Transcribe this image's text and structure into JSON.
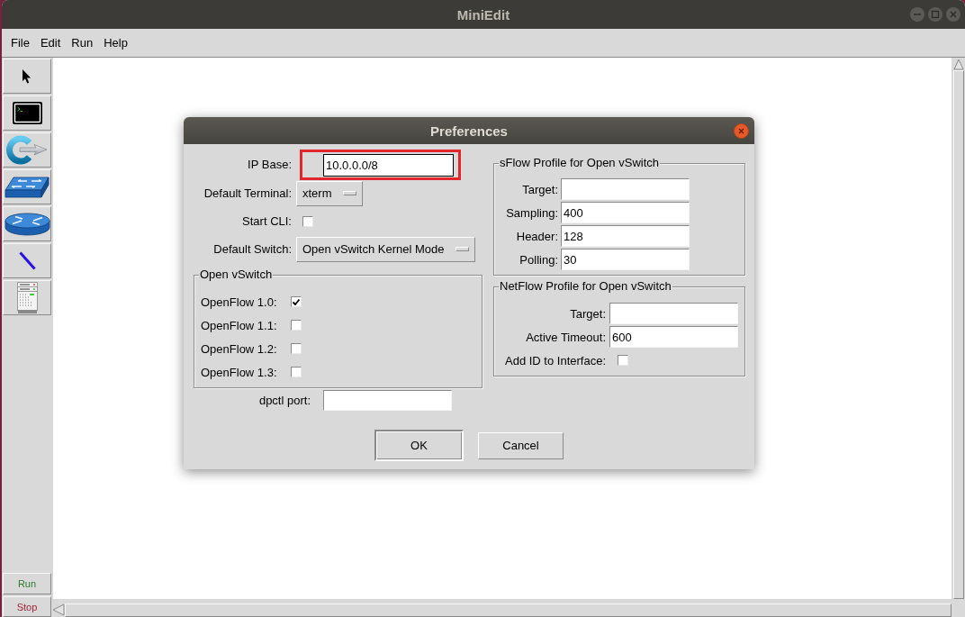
{
  "window": {
    "title": "MiniEdit"
  },
  "menu_bar": [
    "File",
    "Edit",
    "Run",
    "Help"
  ],
  "run_controls": [
    {
      "label": "Run",
      "color": "#2e7d32"
    },
    {
      "label": "Stop",
      "color": "#a3243b"
    }
  ],
  "dialog": {
    "title": "Preferences",
    "general": [
      {
        "kind": "text",
        "label": "IP Base:",
        "value": "10.0.0.0/8",
        "highlighted": true,
        "focused": true
      },
      {
        "kind": "menu",
        "label": "Default Terminal:",
        "value": "xterm"
      },
      {
        "kind": "checkbox",
        "label": "Start CLI:",
        "checked": false
      },
      {
        "kind": "menu",
        "label": "Default Switch:",
        "value": "Open vSwitch Kernel Mode"
      }
    ],
    "open_vswitch": {
      "title": "Open vSwitch",
      "options": [
        {
          "label": "OpenFlow 1.0:",
          "checked": true
        },
        {
          "label": "OpenFlow 1.1:",
          "checked": false
        },
        {
          "label": "OpenFlow 1.2:",
          "checked": false
        },
        {
          "label": "OpenFlow 1.3:",
          "checked": false
        }
      ]
    },
    "dpctl_port": {
      "label": "dpctl port:"
    },
    "sflow": {
      "title": "sFlow Profile for Open vSwitch",
      "fields": [
        {
          "label": "Target:"
        },
        {
          "label": "Sampling:",
          "value": "400"
        },
        {
          "label": "Header:",
          "value": "128"
        },
        {
          "label": "Polling:",
          "value": "30"
        }
      ]
    },
    "netflow": {
      "title": "NetFlow Profile for Open vSwitch",
      "fields": [
        {
          "kind": "text",
          "label": "Target:"
        },
        {
          "kind": "text",
          "label": "Active Timeout:",
          "value": "600"
        },
        {
          "kind": "checkbox",
          "label": "Add ID to Interface:",
          "checked": false
        }
      ]
    },
    "buttons": [
      {
        "label": "OK",
        "default": true
      },
      {
        "label": "Cancel",
        "default": false
      }
    ]
  }
}
